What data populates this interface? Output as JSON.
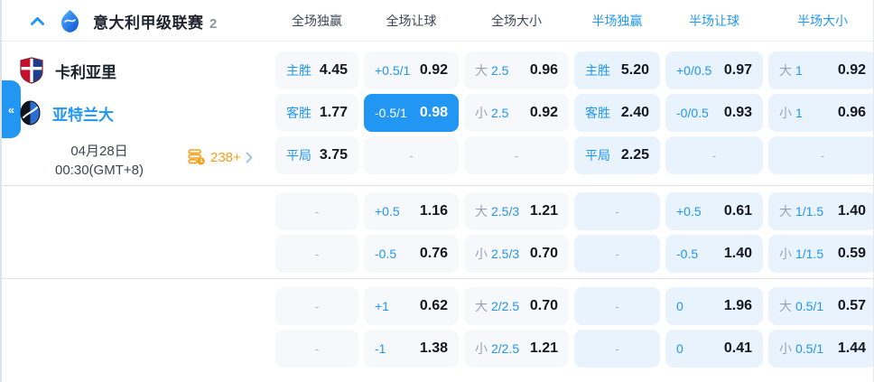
{
  "header": {
    "title": "意大利甲级联赛",
    "count": "2",
    "collapse_glyph": "«",
    "columns": [
      "全场独赢",
      "全场让球",
      "全场大小",
      "半场独赢",
      "半场让球",
      "半场大小"
    ]
  },
  "match": {
    "home_team": "卡利亚里",
    "away_team": "亚特兰大",
    "date": "04月28日",
    "time": "00:30(GMT+8)",
    "more_count": "238+"
  },
  "colors": {
    "accent_blue": "#2196f3",
    "highlight_cell_bg": "#2196f3",
    "full_cell_bg": "#f6f8fb",
    "half_cell_bg": "#e9f3fd",
    "orange": "#f9a01b",
    "value_text": "#14181f",
    "muted_gray": "#99a2b4"
  },
  "odds": {
    "groups": [
      {
        "rows": [
          {
            "cells": [
              {
                "label": "主胜",
                "value": "4.45"
              },
              {
                "hcp": "+0.5/1",
                "value": "0.92"
              },
              {
                "ou": "大",
                "line": "2.5",
                "value": "0.96"
              },
              {
                "label": "主胜",
                "value": "5.20"
              },
              {
                "hcp": "+0/0.5",
                "value": "0.97"
              },
              {
                "ou": "大",
                "line": "1",
                "value": "0.92"
              }
            ]
          },
          {
            "cells": [
              {
                "label": "客胜",
                "value": "1.77"
              },
              {
                "hcp": "-0.5/1",
                "value": "0.98",
                "highlight": true
              },
              {
                "ou": "小",
                "line": "2.5",
                "value": "0.92"
              },
              {
                "label": "客胜",
                "value": "2.40"
              },
              {
                "hcp": "-0/0.5",
                "value": "0.93"
              },
              {
                "ou": "小",
                "line": "1",
                "value": "0.96"
              }
            ]
          },
          {
            "cells": [
              {
                "label": "平局",
                "value": "3.75"
              },
              {
                "dash": "-"
              },
              {
                "dash": "-"
              },
              {
                "label": "平局",
                "value": "2.25"
              },
              {
                "dash": "-"
              },
              {
                "dash": "-"
              }
            ]
          }
        ]
      },
      {
        "rows": [
          {
            "cells": [
              {
                "dash": "-"
              },
              {
                "hcp": "+0.5",
                "value": "1.16"
              },
              {
                "ou": "大",
                "line": "2.5/3",
                "value": "1.21"
              },
              {
                "dash": "-"
              },
              {
                "hcp": "+0.5",
                "value": "0.61"
              },
              {
                "ou": "大",
                "line": "1/1.5",
                "value": "1.40"
              }
            ]
          },
          {
            "cells": [
              {
                "dash": "-"
              },
              {
                "hcp": "-0.5",
                "value": "0.76"
              },
              {
                "ou": "小",
                "line": "2.5/3",
                "value": "0.70"
              },
              {
                "dash": "-"
              },
              {
                "hcp": "-0.5",
                "value": "1.40"
              },
              {
                "ou": "小",
                "line": "1/1.5",
                "value": "0.59"
              }
            ]
          }
        ]
      },
      {
        "rows": [
          {
            "cells": [
              {
                "dash": "-"
              },
              {
                "hcp": "+1",
                "value": "0.62"
              },
              {
                "ou": "大",
                "line": "2/2.5",
                "value": "0.70"
              },
              {
                "dash": "-"
              },
              {
                "hcp": "0",
                "value": "1.96"
              },
              {
                "ou": "大",
                "line": "0.5/1",
                "value": "0.57"
              }
            ]
          },
          {
            "cells": [
              {
                "dash": "-"
              },
              {
                "hcp": "-1",
                "value": "1.38"
              },
              {
                "ou": "小",
                "line": "2/2.5",
                "value": "1.21"
              },
              {
                "dash": "-"
              },
              {
                "hcp": "0",
                "value": "0.41"
              },
              {
                "ou": "小",
                "line": "0.5/1",
                "value": "1.44"
              }
            ]
          }
        ]
      }
    ]
  }
}
